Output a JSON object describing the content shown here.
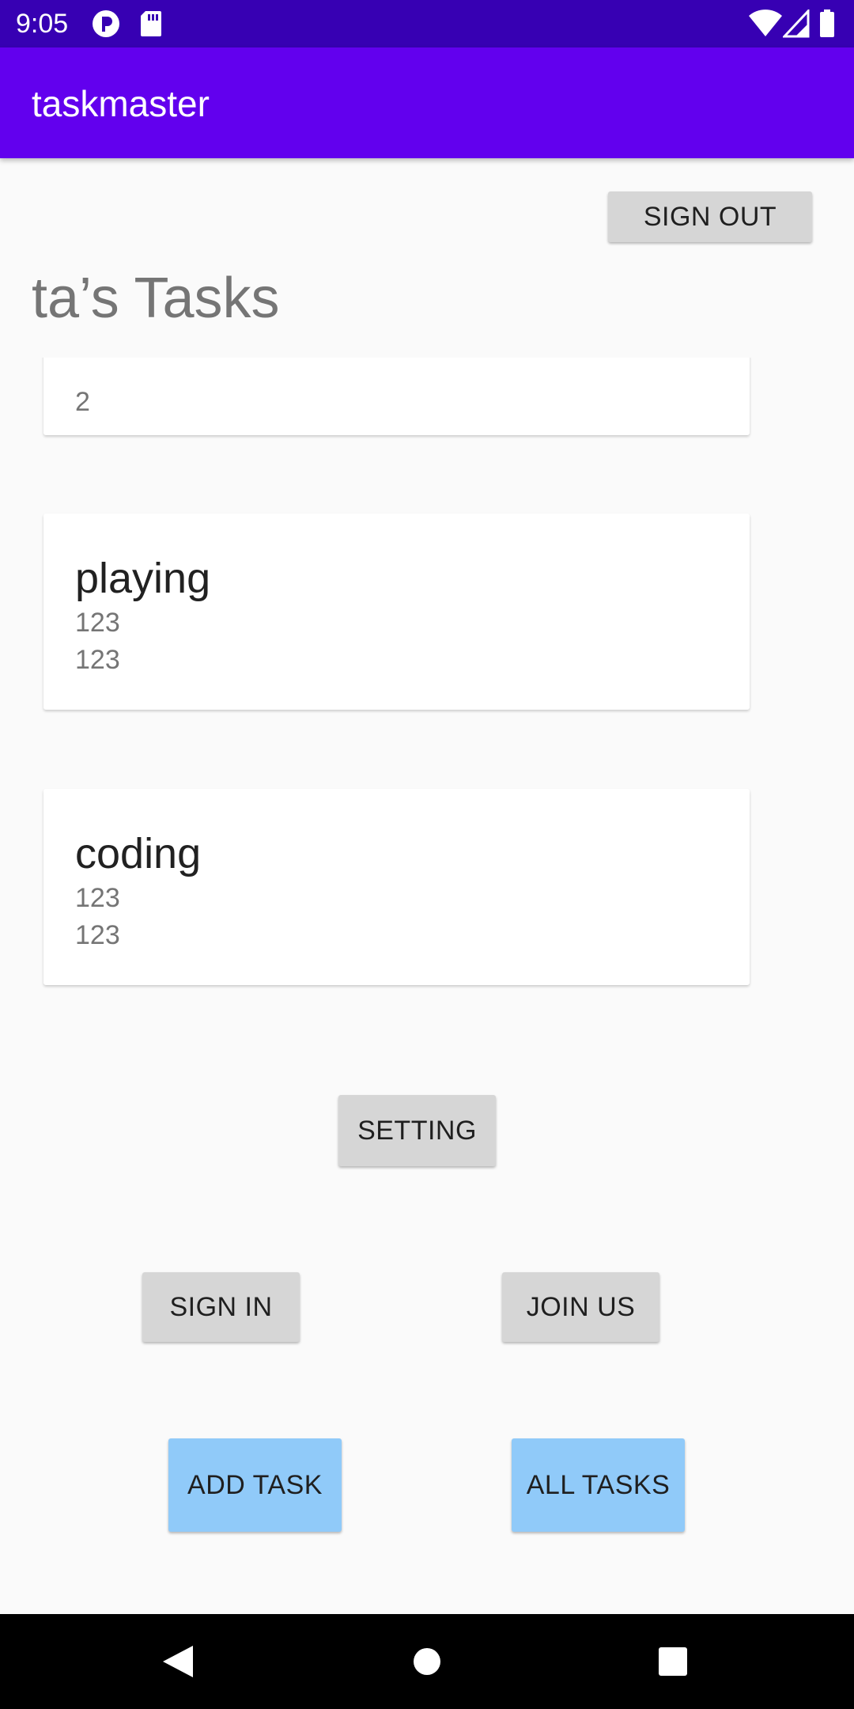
{
  "status_bar": {
    "time": "9:05",
    "left_icons": [
      "notification-icon",
      "sd-card-icon"
    ],
    "right_icons": [
      "wifi-icon",
      "cellular-signal-icon",
      "battery-icon"
    ]
  },
  "app_bar": {
    "title": "taskmaster"
  },
  "header": {
    "sign_out_label": "SIGN OUT",
    "heading": "ta’s Tasks"
  },
  "tasks": [
    {
      "title": "",
      "lines": [
        "",
        "2"
      ]
    },
    {
      "title": "playing",
      "lines": [
        "123",
        "123"
      ]
    },
    {
      "title": "coding",
      "lines": [
        "123",
        "123"
      ]
    }
  ],
  "buttons": {
    "setting": "SETTING",
    "sign_in": "SIGN IN",
    "join_us": "JOIN US",
    "add_task": "ADD TASK",
    "all_tasks": "ALL TASKS"
  },
  "nav_bar": {
    "icons": [
      "back-icon",
      "home-icon",
      "recents-icon"
    ]
  },
  "colors": {
    "status_bar": "#3700b3",
    "app_bar": "#6200ee",
    "button": "#d6d6d6",
    "accent_button": "#90caf9",
    "background": "#fafafa"
  }
}
